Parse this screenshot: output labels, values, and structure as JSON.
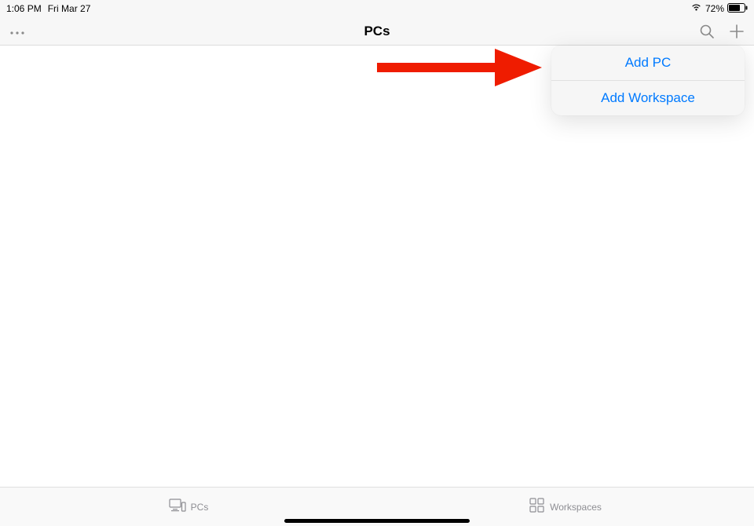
{
  "statusBar": {
    "time": "1:06 PM",
    "date": "Fri Mar 27",
    "batteryPercent": "72%"
  },
  "nav": {
    "title": "PCs"
  },
  "popover": {
    "items": [
      {
        "label": "Add PC"
      },
      {
        "label": "Add Workspace"
      }
    ]
  },
  "tabs": {
    "pcs": "PCs",
    "workspaces": "Workspaces"
  }
}
